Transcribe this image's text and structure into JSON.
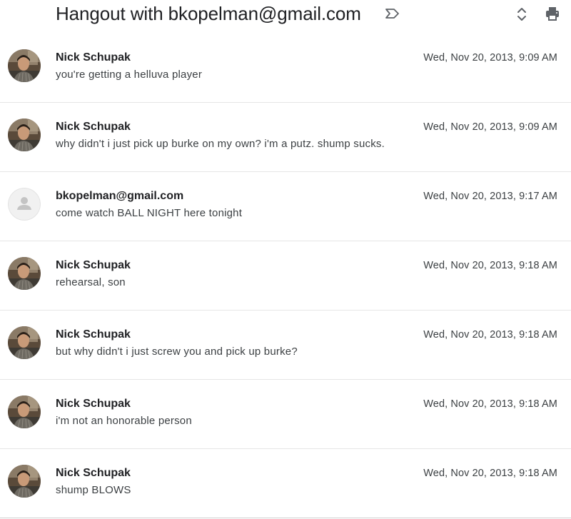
{
  "header": {
    "subject": "Hangout with bkopelman@gmail.com",
    "icons": [
      "label-important-icon",
      "expand-collapse-icon",
      "print-icon"
    ]
  },
  "messages": [
    {
      "sender": "Nick Schupak",
      "snippet": "you're getting a helluva player",
      "date": "Wed, Nov 20, 2013, 9:09 AM",
      "avatar": "photo"
    },
    {
      "sender": "Nick Schupak",
      "snippet": "why didn't i just pick up burke on my own? i'm a putz. shump sucks.",
      "date": "Wed, Nov 20, 2013, 9:09 AM",
      "avatar": "photo"
    },
    {
      "sender": "bkopelman@gmail.com",
      "snippet": "come watch BALL NIGHT here tonight",
      "date": "Wed, Nov 20, 2013, 9:17 AM",
      "avatar": "placeholder"
    },
    {
      "sender": "Nick Schupak",
      "snippet": "rehearsal, son",
      "date": "Wed, Nov 20, 2013, 9:18 AM",
      "avatar": "photo"
    },
    {
      "sender": "Nick Schupak",
      "snippet": "but why didn't i just screw you and pick up burke?",
      "date": "Wed, Nov 20, 2013, 9:18 AM",
      "avatar": "photo"
    },
    {
      "sender": "Nick Schupak",
      "snippet": "i'm not an honorable person",
      "date": "Wed, Nov 20, 2013, 9:18 AM",
      "avatar": "photo"
    },
    {
      "sender": "Nick Schupak",
      "snippet": "shump BLOWS",
      "date": "Wed, Nov 20, 2013, 9:18 AM",
      "avatar": "photo"
    }
  ]
}
